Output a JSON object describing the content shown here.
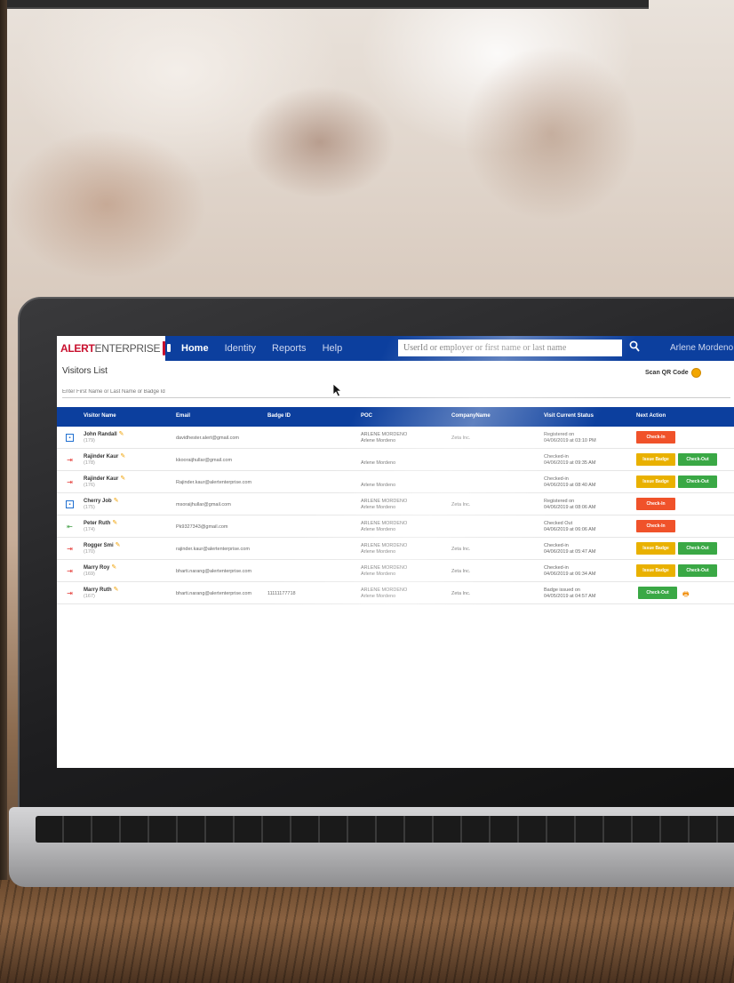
{
  "nav": {
    "logo_alert": "ALERT",
    "logo_enterprise": "ENTERPRISE",
    "items": [
      {
        "label": "Home",
        "active": true
      },
      {
        "label": "Identity",
        "active": false
      },
      {
        "label": "Reports",
        "active": false
      },
      {
        "label": "Help",
        "active": false
      }
    ],
    "search_placeholder": "UserId or employer or first name or last name",
    "user_name": "Arlene Mordeno"
  },
  "page": {
    "title": "Visitors List",
    "scan_qr_label": "Scan QR Code",
    "filter_placeholder": "Enter First Name or Last Name or Badge Id"
  },
  "table": {
    "columns": [
      "Visitor Name",
      "Email",
      "Badge ID",
      "POC",
      "CompanyName",
      "Visit Current Status",
      "Next Action"
    ],
    "rows": [
      {
        "name": "John Randall",
        "id": "(179)",
        "email": "davidhester.alert@gmail.com",
        "badge": "",
        "poc1": "ARLENE MORDENO",
        "poc2": "Arlene Mordeno",
        "company": "Zeta Inc.",
        "status1": "Registered on",
        "status2": "04/06/2019 at 03:10 PM",
        "icon": "id"
      },
      {
        "name": "Rajinder Kaur",
        "id": "(178)",
        "email": "kkooraijhullar@gmail.com",
        "badge": "",
        "poc1": "",
        "poc2": "Arlene Mordeno",
        "company": "",
        "status1": "Checked-in",
        "status2": "04/06/2019 at 09:35 AM",
        "icon": "in"
      },
      {
        "name": "Rajinder Kaur",
        "id": "(176)",
        "email": "Rajinder.kaur@alertenterprise.com",
        "badge": "",
        "poc1": "",
        "poc2": "Arlene Mordeno",
        "company": "",
        "status1": "Checked-in",
        "status2": "04/06/2019 at 08:40 AM",
        "icon": "in"
      },
      {
        "name": "Cherry Job",
        "id": "(175)",
        "email": "msoraijhullar@gmail.com",
        "badge": "",
        "poc1": "ARLENE MORDENO",
        "poc2": "Arlene Mordeno",
        "company": "Zeta Inc.",
        "status1": "Registered on",
        "status2": "04/06/2019 at 08:06 AM",
        "icon": "id"
      },
      {
        "name": "Peter Ruth",
        "id": "(174)",
        "email": "Pk9327343@gmail.com",
        "badge": "",
        "poc1": "ARLENE MORDENO",
        "poc2": "Arlene Mordeno",
        "company": "",
        "status1": "Checked Out",
        "status2": "04/06/2019 at 06:06 AM",
        "icon": "out"
      },
      {
        "name": "Rogger Smi",
        "id": "(170)",
        "email": "rajinder.kaur@alertenterprise.com",
        "badge": "",
        "poc1": "ARLENE MORDENO",
        "poc2": "Arlene Mordeno",
        "company": "Zeta Inc.",
        "status1": "Checked-in",
        "status2": "04/06/2019 at 05:47 AM",
        "icon": "in"
      },
      {
        "name": "Marry Roy",
        "id": "(169)",
        "email": "bharti.narang@alertenterprise.com",
        "badge": "",
        "poc1": "ARLENE MORDENO",
        "poc2": "Arlene Mordeno",
        "company": "Zeta Inc.",
        "status1": "Checked-in",
        "status2": "04/06/2019 at 06:34 AM",
        "icon": "in"
      },
      {
        "name": "Marry Ruth",
        "id": "(167)",
        "email": "bharti.narang@alertenterprise.com",
        "badge": "11111177718",
        "poc1": "ARLENE MORDENO",
        "poc2": "Arlene Mordeno",
        "company": "Zeta Inc.",
        "status1": "Badge issued on",
        "status2": "04/05/2019 at 04:57 AM",
        "icon": "in"
      }
    ]
  },
  "actions": {
    "check_in": "Check-In",
    "issue_badge": "Issue Badge",
    "check_out": "Check-Out"
  },
  "colors": {
    "nav_blue": "#0c3f9e",
    "check_in": "#f0522a",
    "issue_badge": "#e9b100",
    "check_out": "#3aa845"
  }
}
